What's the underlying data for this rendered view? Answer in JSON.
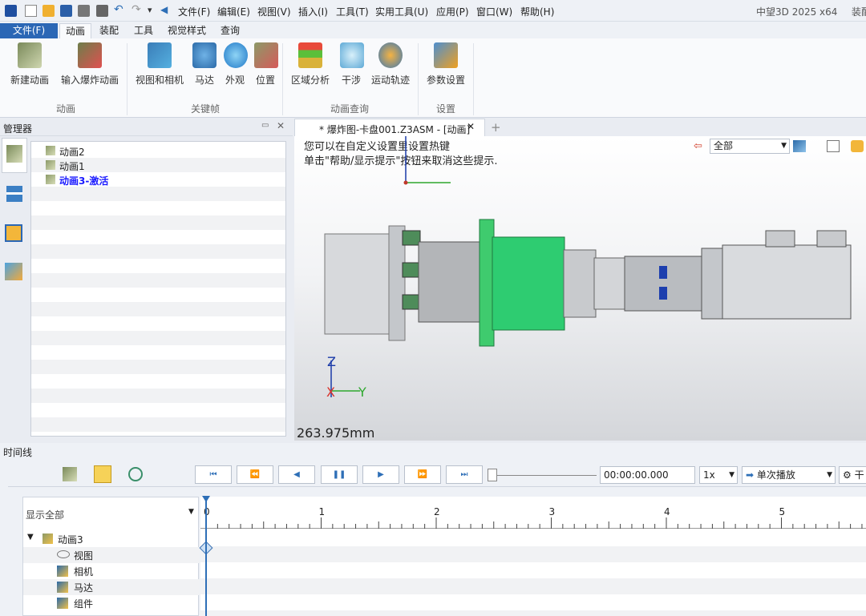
{
  "app": {
    "title": "中望3D 2025 x64",
    "title_right": "装配"
  },
  "menu": [
    "文件(F)",
    "编辑(E)",
    "视图(V)",
    "插入(I)",
    "工具(T)",
    "实用工具(U)",
    "应用(P)",
    "窗口(W)",
    "帮助(H)"
  ],
  "ribbon_tabs": [
    "文件(F)",
    "动画",
    "装配",
    "工具",
    "视觉样式",
    "查询"
  ],
  "ribbon": {
    "buttons": [
      "新建动画",
      "输入爆炸动画",
      "视图和相机",
      "马达",
      "外观",
      "位置",
      "区域分析",
      "干涉",
      "运动轨迹",
      "参数设置"
    ],
    "groups": [
      "动画",
      "关键帧",
      "动画查询",
      "设置"
    ]
  },
  "manager": {
    "title": "管理器",
    "items": [
      "动画2",
      "动画1",
      "动画3-激活"
    ]
  },
  "viewport": {
    "tab_label": "* 爆炸图-卡盘001.Z3ASM - [动画]",
    "hint_line1": "您可以在自定义设置里设置热键",
    "hint_line2": "单击\"帮助/显示提示\"按钮来取消这些提示.",
    "filter_value": "全部",
    "scale_text": "263.975mm",
    "axis_z": "Z",
    "axis_x": "X",
    "axis_y": "Y"
  },
  "timeline": {
    "title": "时间线",
    "time_value": "00:00:00.000",
    "speed": "1x",
    "play_mode": "单次播放",
    "right_label": "干",
    "filter": "显示全部",
    "ruler_labels": [
      "0",
      "1",
      "2",
      "3",
      "4",
      "5"
    ],
    "tree_root": "动画3",
    "tree_items": [
      "视图",
      "相机",
      "马达",
      "组件"
    ]
  },
  "colors": {
    "accent": "#2e6fb7",
    "file_tab": "#2b67b5",
    "green_part": "#2ecc71",
    "active_item": "#1a1aff"
  }
}
